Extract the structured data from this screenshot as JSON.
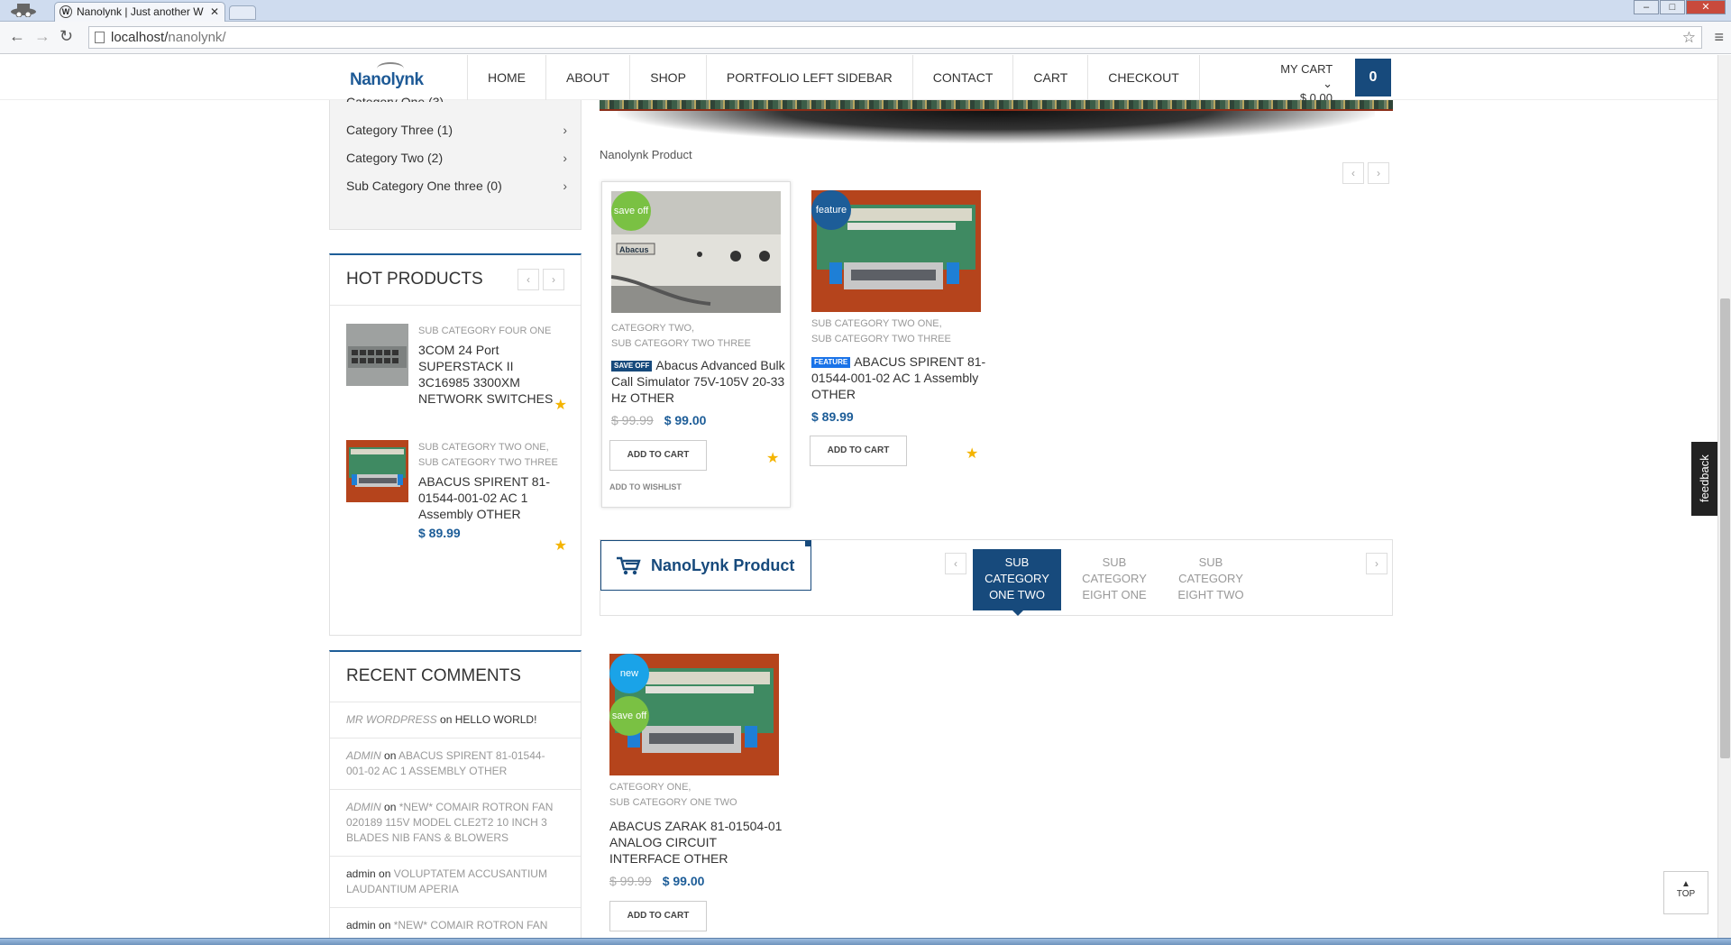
{
  "browser": {
    "tab_title": "Nanolynk | Just another W",
    "url_host": "localhost/",
    "url_path": "nanolynk/"
  },
  "header": {
    "logo": "Nanolynk",
    "nav": [
      "HOME",
      "ABOUT",
      "SHOP",
      "PORTFOLIO LEFT SIDEBAR",
      "CONTACT",
      "CART",
      "CHECKOUT"
    ],
    "mycart_label": "MY CART",
    "mycart_total": "$ 0.00",
    "cart_count": "0"
  },
  "sidebar": {
    "categories": [
      {
        "label": "Category Three (1)"
      },
      {
        "label": "Category Two (2)"
      },
      {
        "label": "Sub Category One three (0)"
      }
    ],
    "hot_products": {
      "title": "HOT PRODUCTS",
      "items": [
        {
          "cats": "SUB CATEGORY FOUR ONE",
          "name": "3COM 24 Port SUPERSTACK II 3C16985 3300XM NETWORK SWITCHES",
          "price": ""
        },
        {
          "cats": "SUB CATEGORY TWO ONE, SUB CATEGORY TWO THREE",
          "name": "ABACUS SPIRENT 81-01544-001-02 AC 1 Assembly OTHER",
          "price": "$ 89.99"
        }
      ]
    },
    "recent_comments": {
      "title": "RECENT COMMENTS",
      "items": [
        {
          "author": "MR WORDPRESS",
          "on": "on",
          "post": "HELLO WORLD!"
        },
        {
          "author": "ADMIN",
          "on": "on",
          "post": "ABACUS SPIRENT 81-01544-001-02 AC 1 ASSEMBLY OTHER"
        },
        {
          "author": "ADMIN",
          "on": "on",
          "post": "*NEW* COMAIR ROTRON FAN 020189 115V MODEL CLE2T2 10 INCH 3 BLADES NIB FANS & BLOWERS"
        },
        {
          "author": "admin",
          "on": "on",
          "post": "VOLUPTATEM ACCUSANTIUM LAUDANTIUM APERIA"
        },
        {
          "author": "admin",
          "on": "on",
          "post": "*NEW* COMAIR ROTRON FAN"
        }
      ]
    }
  },
  "main": {
    "section_title": "Nanolynk Product",
    "products_top": [
      {
        "badge": "save off",
        "cats": [
          "CATEGORY TWO,",
          "SUB CATEGORY TWO THREE"
        ],
        "tag": "SAVE OFF",
        "name": "Abacus Advanced Bulk Call Simulator 75V-105V 20-33 Hz OTHER",
        "old_price": "$ 99.99",
        "price": "$ 99.00",
        "add_to_cart": "ADD TO CART",
        "wishlist": "ADD TO WISHLIST"
      },
      {
        "badge": "feature",
        "cats": [
          "SUB CATEGORY TWO ONE,",
          "SUB CATEGORY TWO THREE"
        ],
        "tag": "FEATURE",
        "name": "ABACUS SPIRENT 81-01544-001-02 AC 1 Assembly OTHER",
        "old_price": "",
        "price": "$ 89.99",
        "add_to_cart": "ADD TO CART"
      }
    ],
    "tabbar": {
      "title": "NanoLynk Product",
      "tabs": [
        "SUB CATEGORY ONE TWO",
        "SUB CATEGORY EIGHT ONE",
        "SUB CATEGORY EIGHT TWO"
      ],
      "active_tab": "SUB CATEGORY ONE TWO"
    },
    "products_bottom": [
      {
        "badge_top": "new",
        "badge_bottom": "save off",
        "cats": [
          "CATEGORY ONE,",
          "SUB CATEGORY ONE TWO"
        ],
        "name": "ABACUS ZARAK 81-01504-01 ANALOG CIRCUIT INTERFACE OTHER",
        "old_price": "$ 99.99",
        "price": "$ 99.00",
        "add_to_cart": "ADD TO CART"
      }
    ]
  },
  "ui": {
    "feedback": "feedback",
    "to_top": "TOP",
    "prev": "‹",
    "next": "›"
  },
  "colors": {
    "brand": "#174a7c",
    "price": "#1d5d98",
    "badge_green": "#7ac143",
    "badge_cyan": "#1aa3e8",
    "star": "#f4b400"
  }
}
